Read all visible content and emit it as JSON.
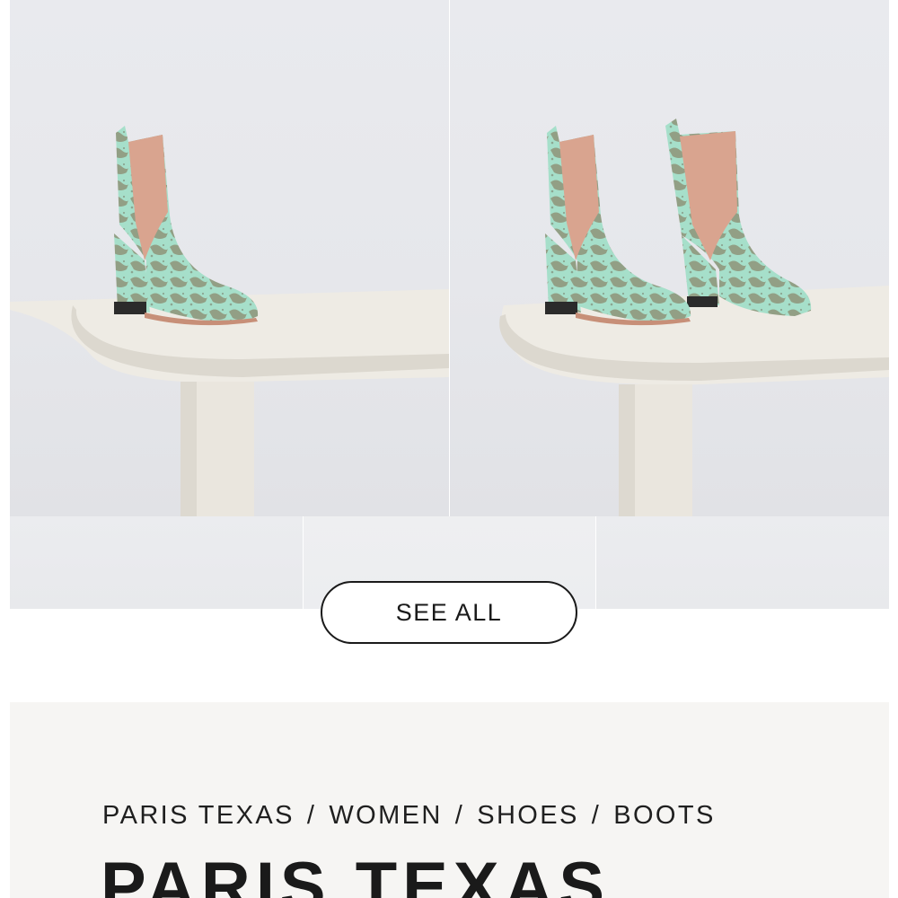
{
  "gallery": {
    "photos": [
      {
        "icon": "boot-single-photo",
        "alt": ""
      },
      {
        "icon": "boot-pair-photo",
        "alt": ""
      }
    ],
    "thumbnails": [
      {
        "icon": "thumbnail"
      },
      {
        "icon": "thumbnail"
      },
      {
        "icon": "thumbnail"
      }
    ],
    "see_all_label": "SEE ALL"
  },
  "breadcrumb": {
    "items": [
      "PARIS TEXAS",
      "WOMEN",
      "SHOES",
      "BOOTS"
    ],
    "separator": "/"
  },
  "product": {
    "brand": "PARIS TEXAS"
  },
  "colors": {
    "panel_bg": "#f6f5f3",
    "photo_bg": "#e7e8ec",
    "text": "#1a1a1a",
    "boot_mint": "#9fdcc6",
    "boot_pattern": "#8a8f74",
    "elastic": "#d9a48f"
  }
}
